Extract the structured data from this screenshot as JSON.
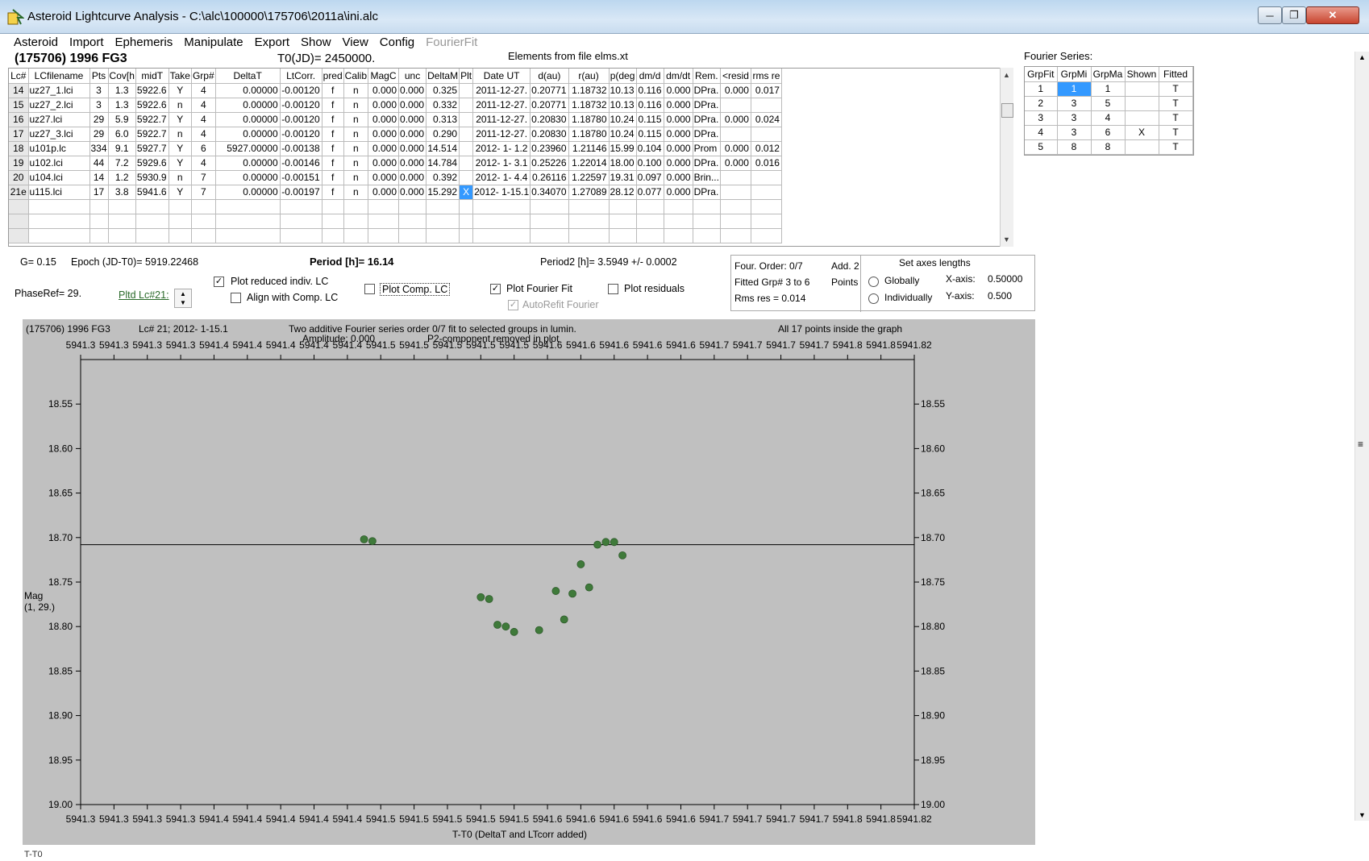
{
  "window": {
    "title": "Asteroid Lightcurve Analysis - C:\\alc\\100000\\175706\\2011a\\ini.alc"
  },
  "menu": [
    "Asteroid",
    "Import",
    "Ephemeris",
    "Manipulate",
    "Export",
    "Show",
    "View",
    "Config",
    "FourierFit"
  ],
  "header": {
    "asteroid": "(175706) 1996 FG3",
    "t0": "T0(JD)= 2450000.",
    "elements": "Elements from file elms.xt",
    "fourier_title": "Fourier Series:"
  },
  "grid": {
    "columns": [
      "Lc#",
      "LCfilename",
      "Pts",
      "Cov[h",
      "midT",
      "Take",
      "Grp#",
      "DeltaT",
      "LtCorr.",
      "pred",
      "Calib",
      "MagC",
      "unc",
      "DeltaM",
      "Plt",
      "Date UT",
      "d(au)",
      "r(au)",
      "p(deg",
      "dm/d",
      "dm/dt",
      "Rem.",
      "<resid",
      "rms re"
    ],
    "rows": [
      [
        "14",
        "uz27_1.lci",
        "3",
        "1.3",
        "5922.6",
        "Y",
        "4",
        "0.00000",
        "-0.00120",
        "f",
        "n",
        "0.000",
        "0.000",
        "0.325",
        "",
        "2011-12-27.",
        "0.20771",
        "1.18732",
        "10.13",
        "0.116",
        "0.000",
        "DPra.",
        "0.000",
        "0.017"
      ],
      [
        "15",
        "uz27_2.lci",
        "3",
        "1.3",
        "5922.6",
        "n",
        "4",
        "0.00000",
        "-0.00120",
        "f",
        "n",
        "0.000",
        "0.000",
        "0.332",
        "",
        "2011-12-27.",
        "0.20771",
        "1.18732",
        "10.13",
        "0.116",
        "0.000",
        "DPra.",
        "",
        ""
      ],
      [
        "16",
        "uz27.lci",
        "29",
        "5.9",
        "5922.7",
        "Y",
        "4",
        "0.00000",
        "-0.00120",
        "f",
        "n",
        "0.000",
        "0.000",
        "0.313",
        "",
        "2011-12-27.",
        "0.20830",
        "1.18780",
        "10.24",
        "0.115",
        "0.000",
        "DPra.",
        "0.000",
        "0.024"
      ],
      [
        "17",
        "uz27_3.lci",
        "29",
        "6.0",
        "5922.7",
        "n",
        "4",
        "0.00000",
        "-0.00120",
        "f",
        "n",
        "0.000",
        "0.000",
        "0.290",
        "",
        "2011-12-27.",
        "0.20830",
        "1.18780",
        "10.24",
        "0.115",
        "0.000",
        "DPra.",
        "",
        ""
      ],
      [
        "18",
        "u101p.lc",
        "334",
        "9.1",
        "5927.7",
        "Y",
        "6",
        "5927.00000",
        "-0.00138",
        "f",
        "n",
        "0.000",
        "0.000",
        "14.514",
        "",
        "2012- 1- 1.2",
        "0.23960",
        "1.21146",
        "15.99",
        "0.104",
        "0.000",
        "Prom",
        "0.000",
        "0.012"
      ],
      [
        "19",
        "u102.lci",
        "44",
        "7.2",
        "5929.6",
        "Y",
        "4",
        "0.00000",
        "-0.00146",
        "f",
        "n",
        "0.000",
        "0.000",
        "14.784",
        "",
        "2012- 1- 3.1",
        "0.25226",
        "1.22014",
        "18.00",
        "0.100",
        "0.000",
        "DPra.",
        "0.000",
        "0.016"
      ],
      [
        "20",
        "u104.lci",
        "14",
        "1.2",
        "5930.9",
        "n",
        "7",
        "0.00000",
        "-0.00151",
        "f",
        "n",
        "0.000",
        "0.000",
        "0.392",
        "",
        "2012- 1- 4.4",
        "0.26116",
        "1.22597",
        "19.31",
        "0.097",
        "0.000",
        "Brin...",
        "",
        ""
      ],
      [
        "21e",
        "u115.lci",
        "17",
        "3.8",
        "5941.6",
        "Y",
        "7",
        "0.00000",
        "-0.00197",
        "f",
        "n",
        "0.000",
        "0.000",
        "15.292",
        "X",
        "2012- 1-15.1",
        "0.34070",
        "1.27089",
        "28.12",
        "0.077",
        "0.000",
        "DPra.",
        "",
        ""
      ]
    ]
  },
  "fourier_series": {
    "columns": [
      "GrpFit",
      "GrpMi",
      "GrpMa",
      "Shown",
      "Fitted"
    ],
    "rows": [
      [
        "1",
        "1",
        "1",
        "",
        "T"
      ],
      [
        "2",
        "3",
        "5",
        "",
        "T"
      ],
      [
        "3",
        "3",
        "4",
        "",
        "T"
      ],
      [
        "4",
        "3",
        "6",
        "X",
        "T"
      ],
      [
        "5",
        "8",
        "8",
        "",
        "T"
      ]
    ]
  },
  "options": {
    "g": "G= 0.15",
    "epoch": "Epoch (JD-T0)= 5919.22468",
    "period": "Period [h]= 16.14",
    "period2": "Period2 [h]= 3.5949 +/- 0.0002",
    "phaseref": "PhaseRef= 29.",
    "pltd_lc": "Pltd Lc#21:",
    "plot_reduced": "Plot reduced indiv. LC",
    "align_comp": "Align with Comp. LC",
    "plot_comp": "Plot Comp. LC",
    "plot_fourier": "Plot Fourier Fit",
    "autorefit": "AutoRefit Fourier",
    "plot_residuals": "Plot residuals",
    "four_order": "Four. Order:  0/7",
    "add": "Add. 2",
    "fitted_grp": "Fitted Grp# 3 to 6",
    "points": "Points",
    "rms_res": "Rms res     = 0.014",
    "set_axes": "Set axes lengths",
    "globally": "Globally",
    "individually": "Individually",
    "xaxis_label": "X-axis:",
    "xaxis_val": "0.50000",
    "yaxis_label": "Y-axis:",
    "yaxis_val": "0.500"
  },
  "plot": {
    "title_left": "(175706) 1996 FG3",
    "lc_label": "Lc# 21; 2012- 1-15.1",
    "desc1": "Two additive Fourier series order 0/7 fit to selected groups in lumin.",
    "desc2": "Amplitude: 0.000",
    "desc3": "P2-component removed in plot",
    "points_info": "All 17 points inside the graph",
    "xlabel": "T-T0 (DeltaT and LTcorr added)",
    "ylabel1": "Mag",
    "ylabel2": "(1, 29.)",
    "bottom_text": "T-T0"
  },
  "chart_data": {
    "type": "scatter",
    "xlabel": "T-T0 (DeltaT and LTcorr added)",
    "ylabel": "Mag (1, 29.)",
    "xlim": [
      5941.32,
      5941.82
    ],
    "ylim": [
      18.5,
      19.0
    ],
    "y_inverted": true,
    "x_tick_labels": [
      "5941.3",
      "5941.3",
      "5941.3",
      "5941.3",
      "5941.4",
      "5941.4",
      "5941.4",
      "5941.4",
      "5941.4",
      "5941.5",
      "5941.5",
      "5941.5",
      "5941.5",
      "5941.5",
      "5941.6",
      "5941.6",
      "5941.6",
      "5941.6",
      "5941.6",
      "5941.7",
      "5941.7",
      "5941.7",
      "5941.7",
      "5941.8",
      "5941.8",
      "5941.82"
    ],
    "y_ticks": [
      18.55,
      18.6,
      18.65,
      18.7,
      18.75,
      18.8,
      18.85,
      18.9,
      18.95,
      19.0
    ],
    "y_tick_labels": [
      "18.55",
      "18.60",
      "18.65",
      "18.70",
      "18.75",
      "18.80",
      "18.85",
      "18.90",
      "18.95",
      "19.00"
    ],
    "fit_line_y": 18.708,
    "point_color": "#3f7a3a",
    "series": [
      {
        "x": [
          5941.49,
          5941.495,
          5941.56,
          5941.565,
          5941.57,
          5941.575,
          5941.58,
          5941.595,
          5941.605,
          5941.61,
          5941.615,
          5941.62,
          5941.625,
          5941.63,
          5941.635,
          5941.64,
          5941.645
        ],
        "y": [
          18.702,
          18.704,
          18.767,
          18.769,
          18.798,
          18.8,
          18.806,
          18.804,
          18.76,
          18.792,
          18.763,
          18.73,
          18.756,
          18.708,
          18.705,
          18.705,
          18.72
        ]
      }
    ]
  }
}
